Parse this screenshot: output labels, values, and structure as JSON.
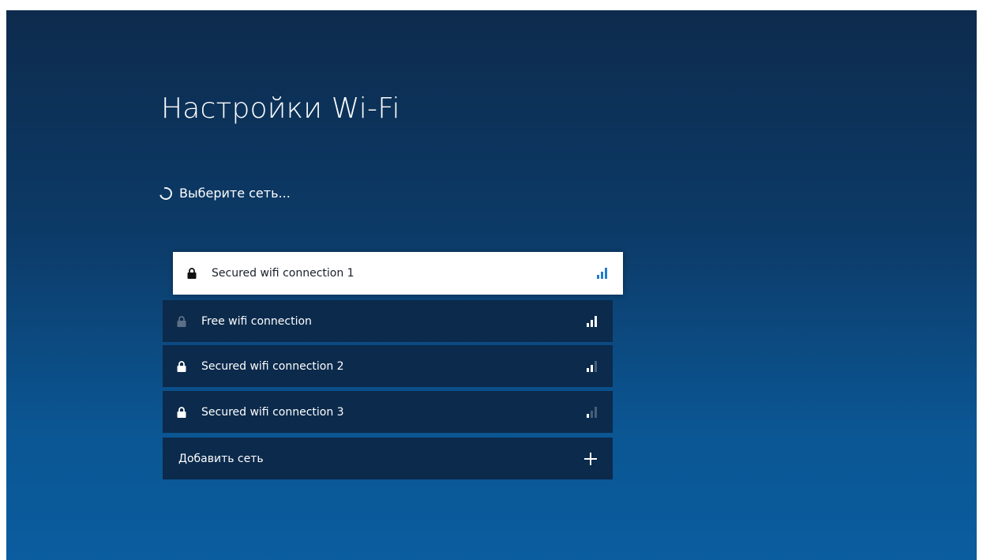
{
  "screen": {
    "title": "Настройки Wi-Fi",
    "status_text": "Выберите сеть..."
  },
  "networks": [
    {
      "name": "Secured wifi connection 1",
      "secured": true,
      "selected": true,
      "signal_bars": 3,
      "lock_icon": "lock-icon"
    },
    {
      "name": "Free wifi connection",
      "secured": false,
      "selected": false,
      "signal_bars": 3,
      "lock_icon": "unlocked-icon"
    },
    {
      "name": "Secured wifi connection 2",
      "secured": true,
      "selected": false,
      "signal_bars": 2,
      "lock_icon": "lock-icon"
    },
    {
      "name": "Secured wifi connection 3",
      "secured": true,
      "selected": false,
      "signal_bars": 1,
      "lock_icon": "lock-icon"
    }
  ],
  "add_network": {
    "label": "Добавить сеть",
    "icon": "plus-icon"
  },
  "colors": {
    "background_top": "#0d2b4d",
    "background_bottom": "#0a5d9f",
    "row_background": "#0b2a4c",
    "selected_background": "#ffffff",
    "selected_signal": "#1f7bd0"
  }
}
